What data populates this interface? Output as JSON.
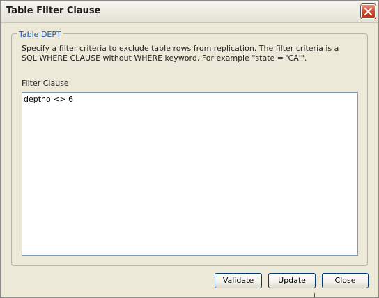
{
  "window": {
    "title": "Table Filter Clause"
  },
  "group": {
    "legend": "Table DEPT",
    "description": "Specify a filter criteria to exclude table rows from replication. The filter criteria is a SQL WHERE CLAUSE without WHERE keyword. For example \"state = 'CA'\"."
  },
  "filter": {
    "label": "Filter Clause",
    "value": "deptno <> 6"
  },
  "buttons": {
    "validate": "Validate",
    "update": "Update",
    "close": "Close"
  },
  "colors": {
    "dialog_bg": "#ece9d8",
    "legend_text": "#1d5ab3",
    "close_button": "#c8462a",
    "input_border": "#7f9db9"
  },
  "icons": {
    "title_close": "close-icon"
  }
}
